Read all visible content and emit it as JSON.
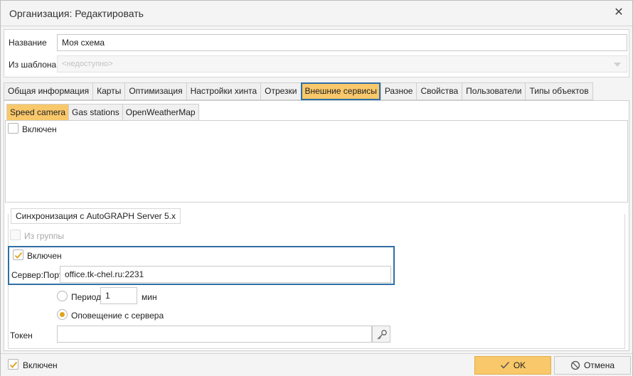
{
  "window": {
    "title": "Организация: Редактировать",
    "close_glyph": "✕"
  },
  "form": {
    "name_label": "Название",
    "name_value": "Моя схема",
    "template_label": "Из шаблона",
    "template_value": "<недоступно>"
  },
  "tabs": [
    {
      "label": "Общая информация",
      "active": false
    },
    {
      "label": "Карты",
      "active": false
    },
    {
      "label": "Оптимизация",
      "active": false
    },
    {
      "label": "Настройки хинта",
      "active": false
    },
    {
      "label": "Отрезки",
      "active": false
    },
    {
      "label": "Внешние сервисы",
      "active": true
    },
    {
      "label": "Разное",
      "active": false
    },
    {
      "label": "Свойства",
      "active": false
    },
    {
      "label": "Пользователи",
      "active": false
    },
    {
      "label": "Типы объектов",
      "active": false
    }
  ],
  "subtabs": [
    {
      "label": "Speed camera",
      "active": true
    },
    {
      "label": "Gas stations",
      "active": false
    },
    {
      "label": "OpenWeatherMap",
      "active": false
    }
  ],
  "speed_camera": {
    "enabled_label": "Включен",
    "enabled": false
  },
  "sync": {
    "legend": "Синхронизация с AutoGRAPH Server 5.x",
    "from_group_label": "Из группы",
    "from_group_checked": false,
    "enabled_label": "Включен",
    "enabled_checked": true,
    "server_port_label": "Сервер:Порт",
    "server_port_value": "office.tk-chel.ru:2231",
    "period_label": "Период",
    "period_value": "1",
    "period_unit": "мин",
    "notify_label": "Оповещение с сервера",
    "selected_mode": "notify",
    "token_label": "Токен",
    "token_value": ""
  },
  "footer": {
    "enabled_label": "Включен",
    "enabled_checked": true,
    "ok_label": "OK",
    "cancel_label": "Отмена"
  },
  "colors": {
    "accent": "#f9c86a",
    "highlight_border": "#2f6fa3",
    "check_color": "#e2a21a"
  },
  "icons": {
    "close": "close-icon",
    "checkmark": "checkmark-icon",
    "key": "key-icon",
    "cancel": "cancel-circle-icon",
    "dropdown": "chevron-down-icon"
  }
}
